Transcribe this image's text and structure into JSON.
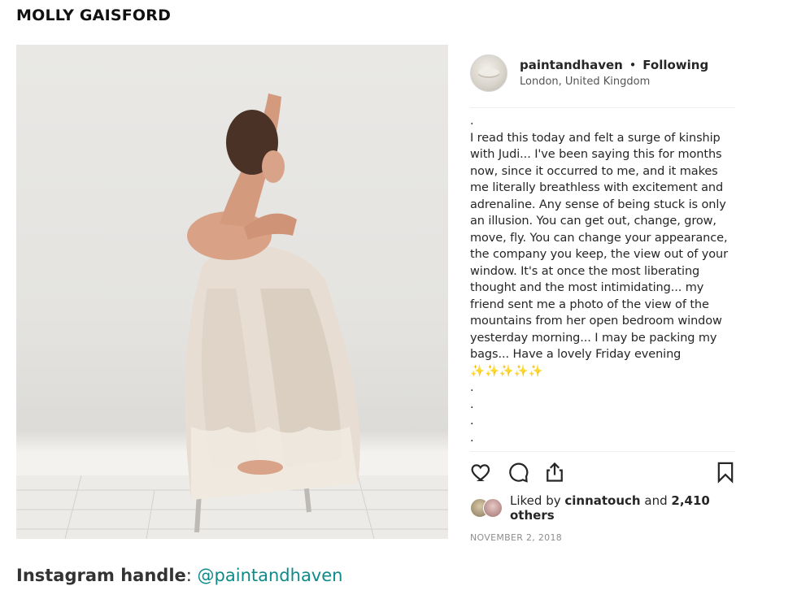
{
  "page": {
    "heading": "MOLLY GAISFORD",
    "handle_label": "Instagram handle",
    "handle_separator": ": ",
    "handle_value": "@paintandhaven"
  },
  "post": {
    "username": "paintandhaven",
    "separator": "•",
    "follow_status": "Following",
    "location": "London, United Kingdom",
    "caption": ".\nI read this today and felt a surge of kinship with Judi... I've been saying this for months now, since it occurred to me, and it makes me literally breathless with excitement and adrenaline. Any sense of being stuck is only an illusion. You can get out, change, grow, move, fly. You can change your appearance, the company you keep, the view out of your window. It's at once the most liberating thought and the most intimidating... my friend sent me a photo of the view of the mountains from her open bedroom window yesterday morning... I may be packing my bags... Have a lovely Friday evening ✨✨✨✨✨\n.\n.\n.\n.",
    "likes_prefix": "Liked by ",
    "liked_by_user": "cinnatouch",
    "likes_middle": " and ",
    "likes_count": "2,410 others",
    "date": "NOVEMBER 2, 2018"
  },
  "icons": [
    "heart-icon",
    "comment-icon",
    "share-icon",
    "bookmark-icon"
  ]
}
